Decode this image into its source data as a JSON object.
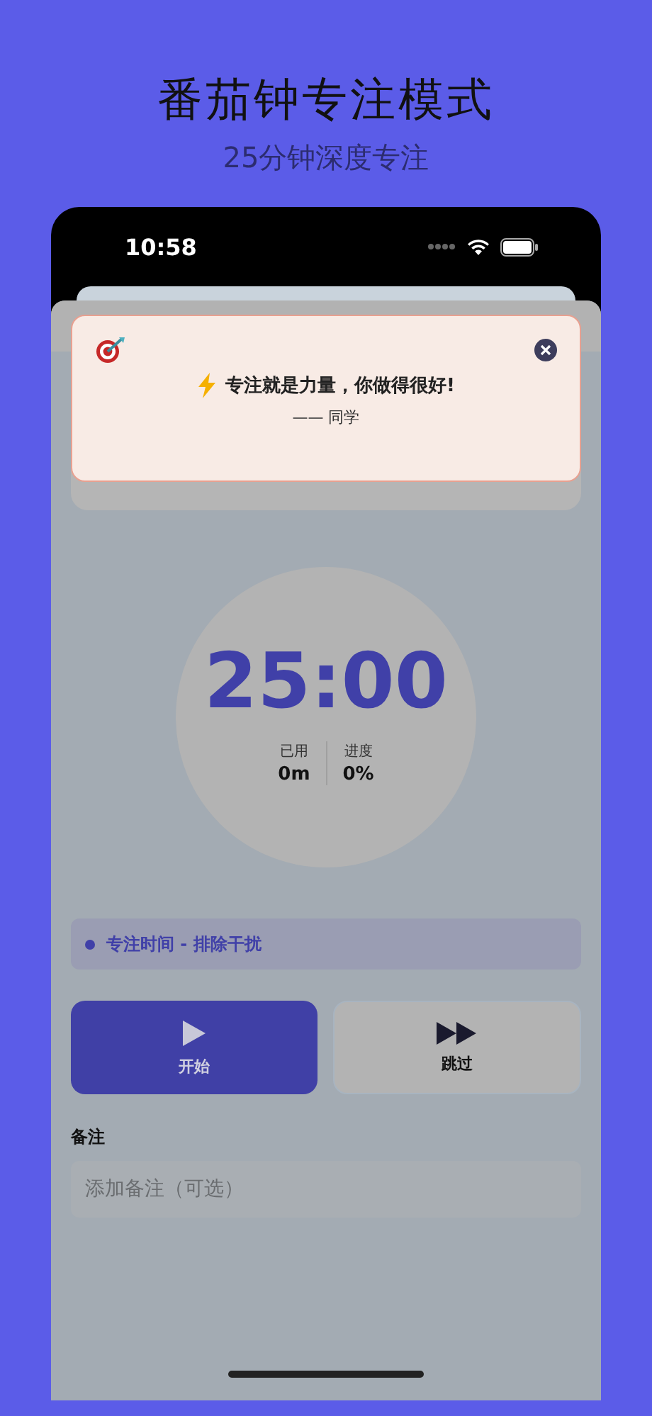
{
  "headline": {
    "title": "番茄钟专注模式",
    "subtitle": "25分钟深度专注"
  },
  "status_bar": {
    "time": "10:58"
  },
  "toast": {
    "message": "专注就是力量，你做得很好!",
    "signature": "—— 同学"
  },
  "timer": {
    "time": "25:00",
    "stats": [
      {
        "label": "已用",
        "value": "0m"
      },
      {
        "label": "进度",
        "value": "0%"
      }
    ]
  },
  "phase": {
    "label": "专注时间 - 排除干扰",
    "color": "#4040a8"
  },
  "buttons": [
    {
      "kind": "play",
      "label": "开始",
      "primary": true
    },
    {
      "kind": "skip",
      "label": "跳过",
      "primary": false
    }
  ],
  "note": {
    "label": "备注",
    "placeholder": "添加备注（可选）"
  }
}
